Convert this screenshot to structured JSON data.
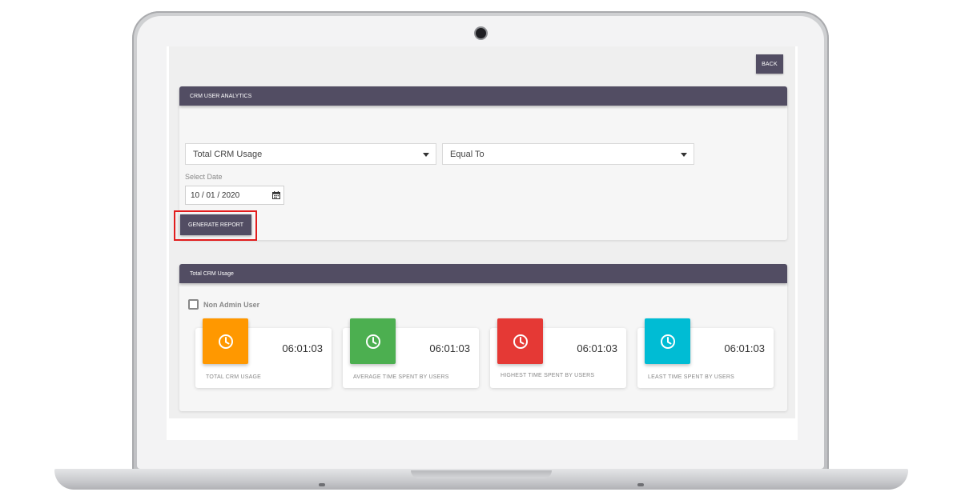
{
  "toolbar": {
    "back_label": "BACK"
  },
  "analytics_panel": {
    "title": "CRM USER ANALYTICS",
    "metric_select": {
      "value": "Total CRM Usage"
    },
    "operator_select": {
      "value": "Equal To"
    },
    "date_label": "Select Date",
    "date_value": "10 / 01 / 2020",
    "generate_label": "GENERATE REPORT"
  },
  "usage_panel": {
    "title": "Total CRM Usage",
    "checkbox_label": "Non Admin User",
    "cards": [
      {
        "value": "06:01:03",
        "label": "TOTAL CRM USAGE",
        "color": "#ff9800",
        "icon": "clock-icon"
      },
      {
        "value": "06:01:03",
        "label": "AVERAGE TIME SPENT BY USERS",
        "color": "#4caf50",
        "icon": "clock-icon"
      },
      {
        "value": "06:01:03",
        "label": "HIGHEST TIME SPENT BY USERS",
        "color": "#e53935",
        "icon": "clock-icon"
      },
      {
        "value": "06:01:03",
        "label": "LEAST TIME SPENT BY USERS",
        "color": "#00bcd4",
        "icon": "clock-icon"
      }
    ]
  },
  "colors": {
    "accent": "#524d63",
    "highlight": "#e11c1c"
  }
}
